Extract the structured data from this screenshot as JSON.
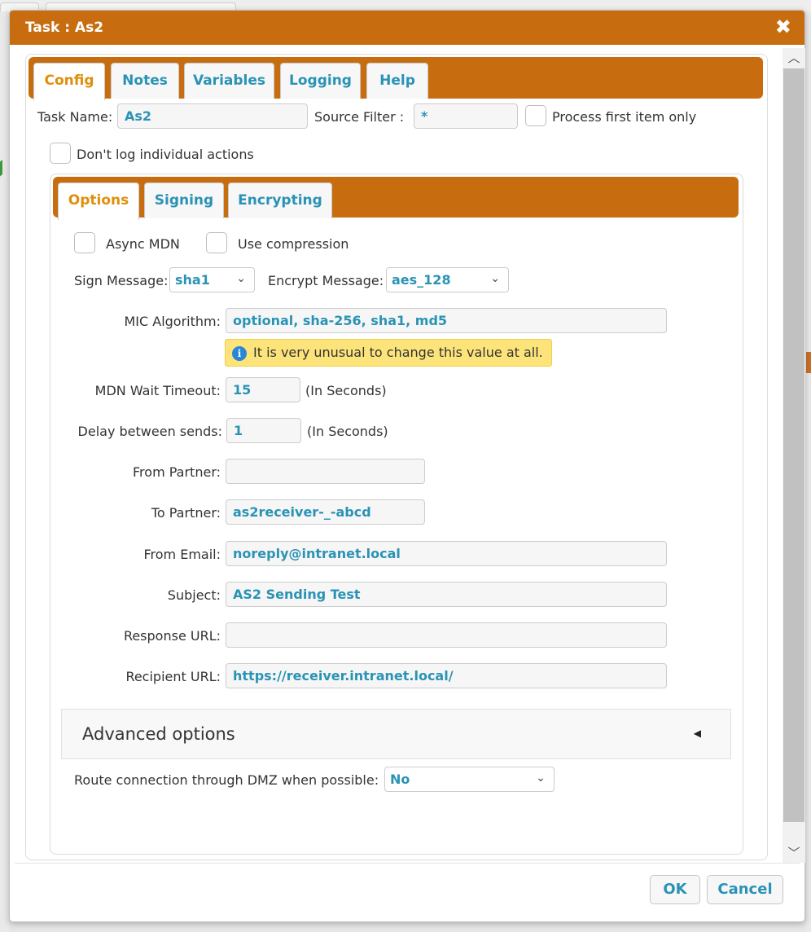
{
  "dialog": {
    "title": "Task : As2",
    "close_glyph": "✖"
  },
  "tabs": [
    "Config",
    "Notes",
    "Variables",
    "Logging",
    "Help"
  ],
  "config": {
    "task_name_label": "Task Name:",
    "task_name_value": "As2",
    "source_filter_label": "Source Filter :",
    "source_filter_value": "*",
    "process_first_label": "Process first item only",
    "dont_log_label": "Don't log individual actions"
  },
  "inner_tabs": [
    "Options",
    "Signing",
    "Encrypting"
  ],
  "options": {
    "async_mdn_label": "Async MDN",
    "use_compression_label": "Use compression",
    "sign_message_label": "Sign Message:",
    "sign_message_value": "sha1",
    "encrypt_message_label": "Encrypt Message:",
    "encrypt_message_value": "aes_128",
    "mic_label": "MIC Algorithm:",
    "mic_value": "optional, sha-256, sha1, md5",
    "mic_warning": "It is very unusual to change this value at all.",
    "mdn_timeout_label": "MDN Wait Timeout:",
    "mdn_timeout_value": "15",
    "mdn_timeout_unit": "(In Seconds)",
    "delay_label": "Delay between sends:",
    "delay_value": "1",
    "delay_unit": "(In Seconds)",
    "from_partner_label": "From Partner:",
    "from_partner_value": "",
    "to_partner_label": "To Partner:",
    "to_partner_value": "as2receiver-_-abcd",
    "from_email_label": "From Email:",
    "from_email_value": "noreply@intranet.local",
    "subject_label": "Subject:",
    "subject_value": "AS2 Sending Test",
    "response_url_label": "Response URL:",
    "response_url_value": "",
    "recipient_url_label": "Recipient URL:",
    "recipient_url_value": "https://receiver.intranet.local/",
    "advanced_label": "Advanced options",
    "dmz_label": "Route connection through DMZ when possible:",
    "dmz_value": "No"
  },
  "footer": {
    "ok_label": "OK",
    "cancel_label": "Cancel"
  },
  "icons": {
    "info": "info-icon",
    "close": "close-icon",
    "chevron": "chevron-down-icon",
    "caret": "caret-left-icon"
  },
  "colors": {
    "accent": "#c76d10",
    "active_tab": "#e08e0b",
    "link": "#2a93b5",
    "warning_bg": "#fde47a"
  }
}
